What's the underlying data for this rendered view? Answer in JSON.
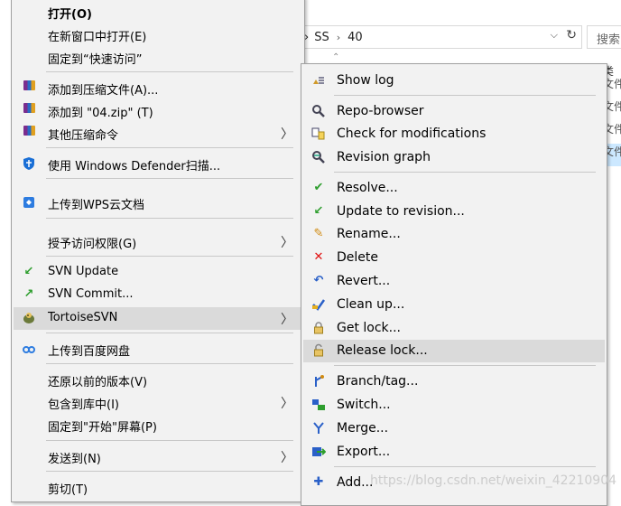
{
  "explorer": {
    "path": [
      "SS",
      "40"
    ],
    "search_placeholder": "搜索",
    "right_column": {
      "header": "类型",
      "cells": [
        "文件",
        "文件",
        "文件",
        "文件"
      ]
    }
  },
  "main_menu": {
    "items": [
      {
        "label": "打开(O)",
        "icon": "none",
        "bold": true
      },
      {
        "label": "在新窗口中打开(E)",
        "icon": "none"
      },
      {
        "label": "固定到“快速访问”",
        "icon": "none"
      },
      {
        "label": "添加到压缩文件(A)...",
        "icon": "winrar-icon"
      },
      {
        "label": "添加到 \"04.zip\" (T)",
        "icon": "winrar-icon"
      },
      {
        "label": "其他压缩命令",
        "icon": "winrar-icon",
        "submenu": true
      },
      {
        "label": "使用 Windows Defender扫描...",
        "icon": "defender-shield-icon"
      },
      {
        "label": "上传到WPS云文档",
        "icon": "wps-cloud-icon"
      },
      {
        "label": "授予访问权限(G)",
        "icon": "none",
        "submenu": true
      },
      {
        "label": "SVN Update",
        "icon": "svn-update-icon"
      },
      {
        "label": "SVN Commit...",
        "icon": "svn-commit-icon"
      },
      {
        "label": "TortoiseSVN",
        "icon": "tortoisesvn-icon",
        "submenu": true
      },
      {
        "label": "上传到百度网盘",
        "icon": "baidu-netdisk-icon"
      },
      {
        "label": "还原以前的版本(V)",
        "icon": "none"
      },
      {
        "label": "包含到库中(I)",
        "icon": "none",
        "submenu": true
      },
      {
        "label": "固定到\"开始\"屏幕(P)",
        "icon": "none"
      },
      {
        "label": "发送到(N)",
        "icon": "none",
        "submenu": true
      },
      {
        "label": "剪切(T)",
        "icon": "none"
      }
    ]
  },
  "svn_submenu": {
    "items": [
      {
        "label": "Show log",
        "icon": "show-log-icon"
      },
      {
        "label": "Repo-browser",
        "icon": "repo-browser-icon"
      },
      {
        "label": "Check for modifications",
        "icon": "check-modifications-icon"
      },
      {
        "label": "Revision graph",
        "icon": "revision-graph-icon"
      },
      {
        "label": "Resolve...",
        "icon": "resolve-icon"
      },
      {
        "label": "Update to revision...",
        "icon": "update-revision-icon"
      },
      {
        "label": "Rename...",
        "icon": "rename-icon"
      },
      {
        "label": "Delete",
        "icon": "delete-icon"
      },
      {
        "label": "Revert...",
        "icon": "revert-icon"
      },
      {
        "label": "Clean up...",
        "icon": "cleanup-icon"
      },
      {
        "label": "Get lock...",
        "icon": "get-lock-icon"
      },
      {
        "label": "Release lock...",
        "icon": "release-lock-icon"
      },
      {
        "label": "Branch/tag...",
        "icon": "branch-tag-icon"
      },
      {
        "label": "Switch...",
        "icon": "switch-icon"
      },
      {
        "label": "Merge...",
        "icon": "merge-icon"
      },
      {
        "label": "Export...",
        "icon": "export-icon"
      },
      {
        "label": "Add...",
        "icon": "add-icon"
      }
    ]
  },
  "watermark": "https://blog.csdn.net/weixin_42210904",
  "colors": {
    "menu_bg": "#f2f2f2",
    "highlight": "#dadada",
    "selection_blue": "#cce8ff"
  }
}
